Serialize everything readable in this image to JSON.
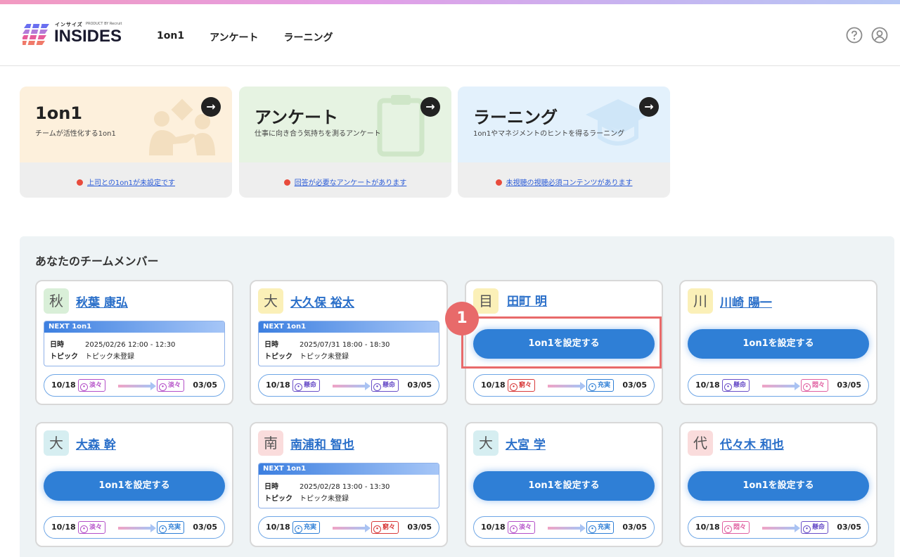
{
  "colors": {
    "accent": "#2f7fd6",
    "alert": "#e84b3c",
    "highlight": "#e86a6a"
  },
  "header": {
    "logo_small": "インサイズ",
    "logo_product": "PRODUCT BY Recruit",
    "logo_main": "INSIDES",
    "nav": [
      "1on1",
      "アンケート",
      "ラーニング"
    ],
    "help_icon": "help-circle-icon",
    "user_icon": "user-circle-icon"
  },
  "features": [
    {
      "title": "1on1",
      "desc": "チームが活性化する1on1",
      "notice": "上司との1on1が未設定です",
      "icon": "handshake-icon"
    },
    {
      "title": "アンケート",
      "desc": "仕事に向き合う気持ちを測るアンケート",
      "notice": "回答が必要なアンケートがあります",
      "icon": "clipboard-icon"
    },
    {
      "title": "ラーニング",
      "desc": "1on1やマネジメントのヒントを得るラーニング",
      "notice": "未視聴の視聴必須コンテンツがあります",
      "icon": "graduation-cap-icon"
    }
  ],
  "team": {
    "title": "あなたのチームメンバー",
    "next_label": "NEXT 1on1",
    "date_label": "日時",
    "topic_label": "トピック",
    "set_label": "1on1を設定する",
    "step": "1",
    "members": [
      {
        "initial": "秋",
        "name": "秋葉 康弘",
        "next": {
          "date": "2025/02/26 12:00 - 12:30",
          "topic": "トピック未登録"
        },
        "from_date": "10/18",
        "from_mood": "淡々",
        "to_mood": "淡々",
        "to_date": "03/05"
      },
      {
        "initial": "大",
        "name": "大久保 裕太",
        "next": {
          "date": "2025/07/31 18:00 - 18:30",
          "topic": "トピック未登録"
        },
        "from_date": "10/18",
        "from_mood": "懸命",
        "to_mood": "懸命",
        "to_date": "03/05"
      },
      {
        "initial": "目",
        "name": "田町 明",
        "from_date": "10/18",
        "from_mood": "窮々",
        "to_mood": "充実",
        "to_date": "03/05"
      },
      {
        "initial": "川",
        "name": "川崎 陽一",
        "from_date": "10/18",
        "from_mood": "懸命",
        "to_mood": "悶々",
        "to_date": "03/05"
      },
      {
        "initial": "大",
        "name": "大森 幹",
        "from_date": "10/18",
        "from_mood": "淡々",
        "to_mood": "充実",
        "to_date": "03/05"
      },
      {
        "initial": "南",
        "name": "南浦和 智也",
        "next": {
          "date": "2025/02/28 13:00 - 13:30",
          "topic": "トピック未登録"
        },
        "from_date": "10/18",
        "from_mood": "充実",
        "to_mood": "窮々",
        "to_date": "03/05"
      },
      {
        "initial": "大",
        "name": "大宮 学",
        "from_date": "10/18",
        "from_mood": "淡々",
        "to_mood": "充実",
        "to_date": "03/05"
      },
      {
        "initial": "代",
        "name": "代々木 和也",
        "from_date": "10/18",
        "from_mood": "悶々",
        "to_mood": "懸命",
        "to_date": "03/05"
      }
    ]
  }
}
